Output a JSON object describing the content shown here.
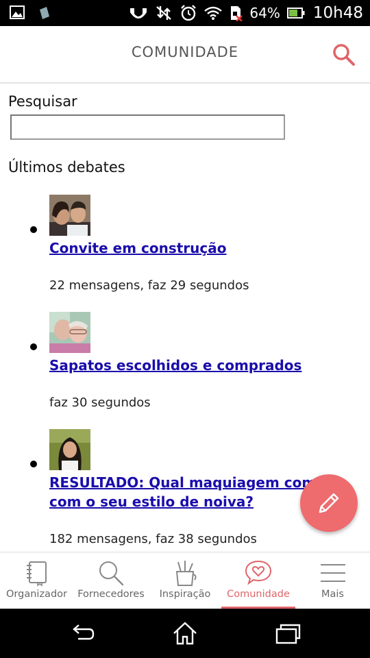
{
  "status_bar": {
    "battery_percent": "64%",
    "time": "10h48"
  },
  "header": {
    "title": "COMUNIDADE"
  },
  "search": {
    "label": "Pesquisar",
    "value": "",
    "placeholder": ""
  },
  "section_title": "Últimos debates",
  "debates": [
    {
      "title": "Convite em construção",
      "meta": "22 mensagens, faz 29 segundos"
    },
    {
      "title": "Sapatos escolhidos e comprados",
      "meta": "faz 30 segundos"
    },
    {
      "title_line1": "RESULTADO: Qual maquiagem comb",
      "title_line2": "com o seu estilo de noiva?",
      "meta": "182 mensagens, faz 38 segundos"
    }
  ],
  "bottom_nav": {
    "items": [
      {
        "label": "Organizador",
        "icon": "notebook-icon"
      },
      {
        "label": "Fornecedores",
        "icon": "search-icon"
      },
      {
        "label": "Inspiração",
        "icon": "pencil-cup-icon"
      },
      {
        "label": "Comunidade",
        "icon": "heart-chat-icon",
        "active": true
      },
      {
        "label": "Mais",
        "icon": "hamburger-menu-icon"
      }
    ]
  },
  "colors": {
    "accent": "#e06468",
    "fab": "#ee6b6e",
    "link": "#1a0dab"
  }
}
